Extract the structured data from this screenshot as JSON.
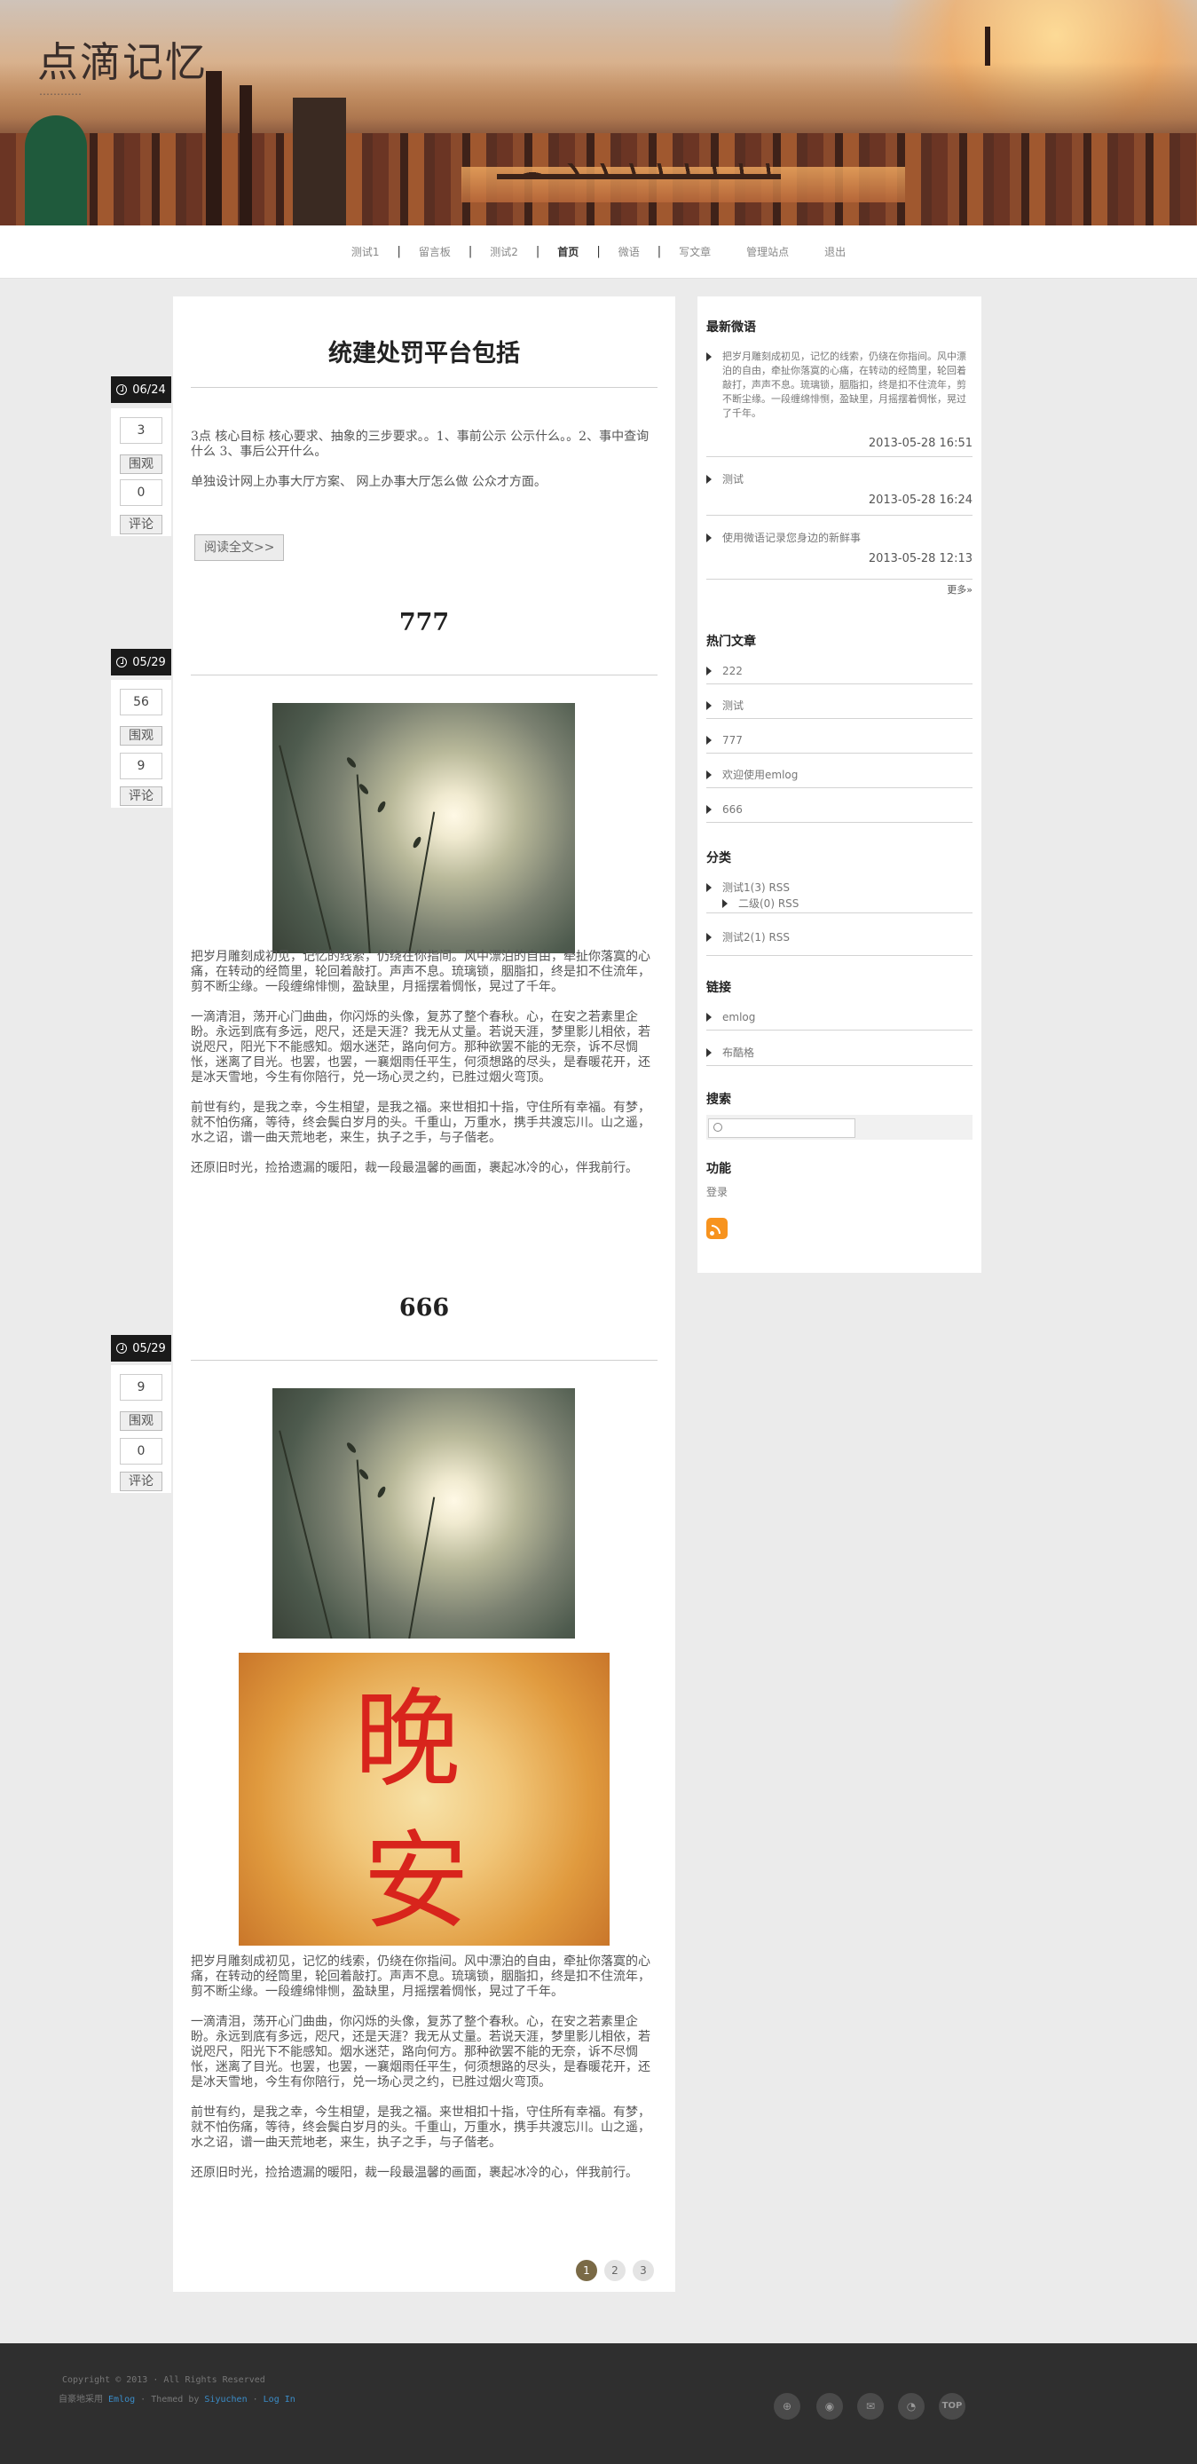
{
  "site": {
    "title": "点滴记忆",
    "subtitle": "…………"
  },
  "nav": {
    "items": [
      {
        "label": "测试1"
      },
      {
        "label": "留言板"
      },
      {
        "label": "测试2"
      },
      {
        "label": "首页",
        "current": true
      },
      {
        "label": "微语"
      },
      {
        "label": "写文章"
      },
      {
        "label": "管理站点"
      },
      {
        "label": "退出"
      }
    ]
  },
  "posts": [
    {
      "date": "06/24",
      "views": "3",
      "views_label": "围观",
      "comments": "0",
      "comments_label": "评论",
      "title": "统建处罚平台包括",
      "paragraphs": [
        "3点 核心目标 核心要求、抽象的三步要求。。1、事前公示 公示什么。。2、事中查询 什么 3、事后公开什么。",
        "单独设计网上办事大厅方案、 网上办事大厅怎么做 公众才方面。"
      ],
      "read_more": "阅读全文>>"
    },
    {
      "date": "05/29",
      "views": "56",
      "views_label": "围观",
      "comments": "9",
      "comments_label": "评论",
      "title": "777",
      "paragraphs": [
        "把岁月雕刻成初见，记忆的线索，仍绕在你指间。风中漂泊的自由，牵扯你落寞的心痛，在转动的经筒里，轮回着敲打。声声不息。琉璃锁，胭脂扣，终是扣不住流年，剪不断尘缘。一段缠绵悱恻，盈缺里，月摇摆着惆怅，晃过了千年。",
        "一滴清泪，荡开心门曲曲，你闪烁的头像，复苏了整个春秋。心，在安之若素里企盼。永远到底有多远，咫尺，还是天涯？我无从丈量。若说天涯，梦里影儿相依，若说咫尺，阳光下不能感知。烟水迷茫，路向何方。那种欲罢不能的无奈，诉不尽惆怅，迷离了目光。也罢，也罢，一襄烟雨任平生，何须想路的尽头，是春暖花开，还是冰天雪地，今生有你陪行，兑一场心灵之约，已胜过烟火弯顶。",
        "前世有约，是我之幸，今生相望，是我之福。来世相扣十指，守住所有幸福。有梦，就不怕伤痛，等待，终会鬓白岁月的头。千重山，万重水，携手共渡忘川。山之遥，水之诏，谱一曲天荒地老，来生，执子之手，与子偕老。",
        "还原旧时光，捡拾遗漏的暖阳，裁一段最温馨的画面，裹起冰冷的心，伴我前行。"
      ]
    },
    {
      "date": "05/29",
      "views": "9",
      "views_label": "围观",
      "comments": "0",
      "comments_label": "评论",
      "title": "666",
      "image_text": [
        "晚",
        "安"
      ],
      "paragraphs": [
        "把岁月雕刻成初见，记忆的线索，仍绕在你指间。风中漂泊的自由，牵扯你落寞的心痛，在转动的经筒里，轮回着敲打。声声不息。琉璃锁，胭脂扣，终是扣不住流年，剪不断尘缘。一段缠绵悱恻，盈缺里，月摇摆着惆怅，晃过了千年。",
        "一滴清泪，荡开心门曲曲，你闪烁的头像，复苏了整个春秋。心，在安之若素里企盼。永远到底有多远，咫尺，还是天涯？我无从丈量。若说天涯，梦里影儿相依，若说咫尺，阳光下不能感知。烟水迷茫，路向何方。那种欲罢不能的无奈，诉不尽惆怅，迷离了目光。也罢，也罢，一襄烟雨任平生，何须想路的尽头，是春暖花开，还是冰天雪地，今生有你陪行，兑一场心灵之约，已胜过烟火弯顶。",
        "前世有约，是我之幸，今生相望，是我之福。来世相扣十指，守住所有幸福。有梦，就不怕伤痛，等待，终会鬓白岁月的头。千重山，万重水，携手共渡忘川。山之遥，水之诏，谱一曲天荒地老，来生，执子之手，与子偕老。",
        "还原旧时光，捡拾遗漏的暖阳，裁一段最温馨的画面，裹起冰冷的心，伴我前行。"
      ]
    }
  ],
  "pager": [
    "1",
    "2",
    "3"
  ],
  "sidebar": {
    "twitter_title": "最新微语",
    "twitters": [
      {
        "text": "把岁月雕刻成初见，记忆的线索，仍绕在你指间。风中漂泊的自由，牵扯你落寞的心痛，在转动的经筒里，轮回着敲打，声声不息。琉璃锁，胭脂扣，终是扣不住流年，剪不断尘缘。一段缠绵悱恻，盈缺里，月摇摆着惆怅，晃过了千年。",
        "date": "2013-05-28 16:51"
      },
      {
        "text": "测试",
        "date": "2013-05-28 16:24"
      },
      {
        "text": "使用微语记录您身边的新鲜事",
        "date": "2013-05-28 12:13"
      }
    ],
    "more": "更多»",
    "hot_title": "热门文章",
    "hot": [
      "222",
      "测试",
      "777",
      "欢迎使用emlog",
      "666"
    ],
    "cat_title": "分类",
    "cats": [
      "测试1(3) RSS",
      "二级(0) RSS",
      "测试2(1) RSS"
    ],
    "link_title": "链接",
    "links": [
      "emlog",
      "布酷格"
    ],
    "search_title": "搜索",
    "search_placeholder": "",
    "func_title": "功能",
    "login": "登录"
  },
  "footer": {
    "copyright": "Copyright © 2013 · All Rights Reserved",
    "powered_prefix": "自豪地采用",
    "powered_link": "Emlog",
    "theme_prefix": " · Themed by ",
    "theme_link": "Siyuchen",
    "sep": " · ",
    "login_link": "Log In",
    "icons": [
      "qq-icon",
      "weibo-icon",
      "mail-icon",
      "rss-icon",
      "top-icon"
    ],
    "top_label": "TOP"
  },
  "colors": {
    "page_bg": "#ebebeb",
    "footer_bg": "#2f2f2f",
    "pager_active": "#7a6a46",
    "link_blue": "#3a8cc8"
  }
}
